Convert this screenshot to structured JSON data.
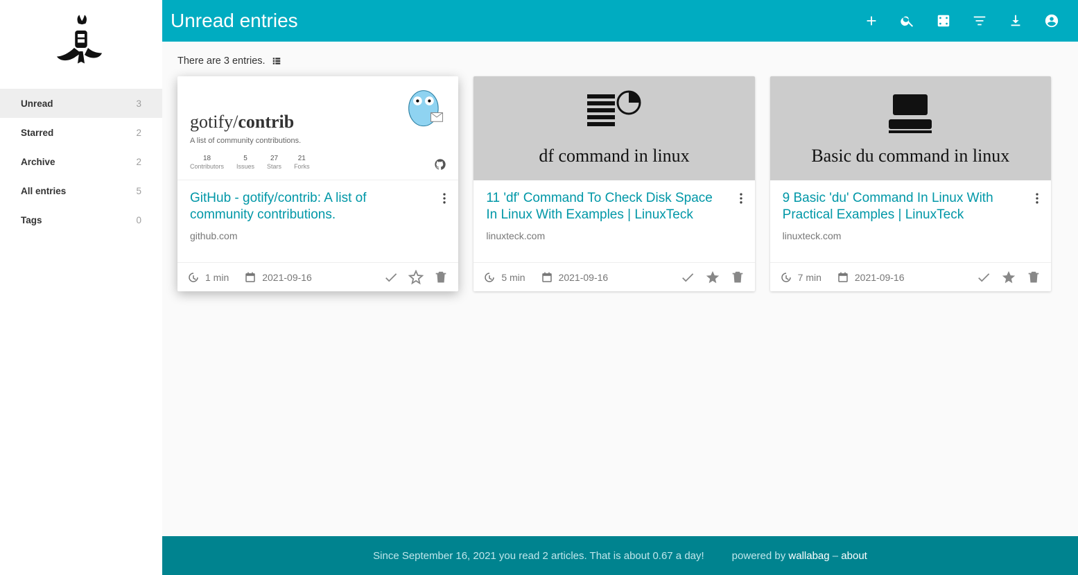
{
  "header": {
    "title": "Unread entries"
  },
  "sidebar": {
    "items": [
      {
        "label": "Unread",
        "count": "3",
        "active": true
      },
      {
        "label": "Starred",
        "count": "2",
        "active": false
      },
      {
        "label": "Archive",
        "count": "2",
        "active": false
      },
      {
        "label": "All entries",
        "count": "5",
        "active": false
      },
      {
        "label": "Tags",
        "count": "0",
        "active": false
      }
    ]
  },
  "content": {
    "summary": "There are 3 entries."
  },
  "entries": [
    {
      "title": "GitHub - gotify/contrib: A list of community contributions.",
      "domain": "github.com",
      "read_time": "1 min",
      "date": "2021-09-16",
      "starred": false,
      "preview": {
        "type": "github",
        "repo_owner": "gotify/",
        "repo_name": "contrib",
        "subtitle": "A list of community contributions.",
        "stats": [
          {
            "num": "18",
            "lbl": "Contributors"
          },
          {
            "num": "5",
            "lbl": "Issues"
          },
          {
            "num": "27",
            "lbl": "Stars"
          },
          {
            "num": "21",
            "lbl": "Forks"
          }
        ]
      }
    },
    {
      "title": "11 'df' Command To Check Disk Space In Linux With Examples | LinuxTeck",
      "domain": "linuxteck.com",
      "read_time": "5 min",
      "date": "2021-09-16",
      "starred": true,
      "preview": {
        "type": "label",
        "label": "df command in linux",
        "icon": "disks"
      }
    },
    {
      "title": "9 Basic 'du' Command In Linux With Practical Examples | LinuxTeck",
      "domain": "linuxteck.com",
      "read_time": "7 min",
      "date": "2021-09-16",
      "starred": true,
      "preview": {
        "type": "label",
        "label": "Basic du command in linux",
        "icon": "hdd"
      }
    }
  ],
  "footer": {
    "stats": "Since September 16, 2021 you read 2 articles. That is about 0.67 a day!",
    "powered_prefix": "powered by ",
    "brand": "wallabag",
    "sep": " – ",
    "about": "about"
  }
}
